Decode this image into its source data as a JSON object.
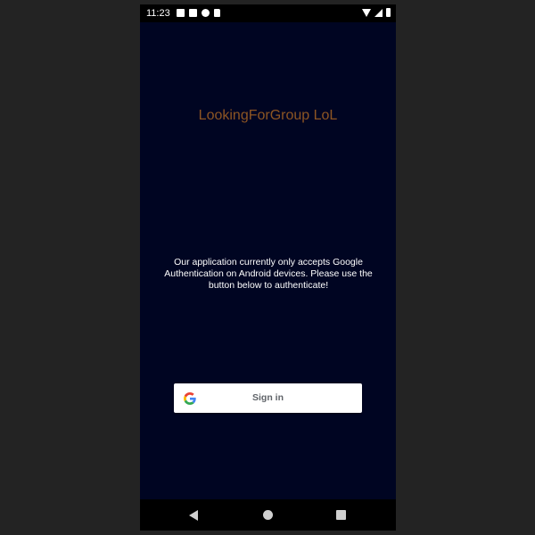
{
  "status_bar": {
    "time": "11:23",
    "notification_icons": [
      "a-icon",
      "photo-icon",
      "circle-p-icon",
      "sd-card-icon"
    ],
    "system_icons": [
      "wifi-icon",
      "signal-icon",
      "battery-icon"
    ]
  },
  "app": {
    "title": "LookingForGroup LoL",
    "info_text": "Our application currently only accepts Google Authentication on Android devices. Please use the button below to authenticate!",
    "signin_button": {
      "label": "Sign in",
      "icon": "google-icon"
    }
  },
  "navigation": {
    "buttons": [
      "back",
      "home",
      "recents"
    ]
  },
  "colors": {
    "background": "#000522",
    "title": "#8d5523",
    "text": "#ffffff",
    "button_bg": "#ffffff",
    "button_text": "#5f6368"
  }
}
